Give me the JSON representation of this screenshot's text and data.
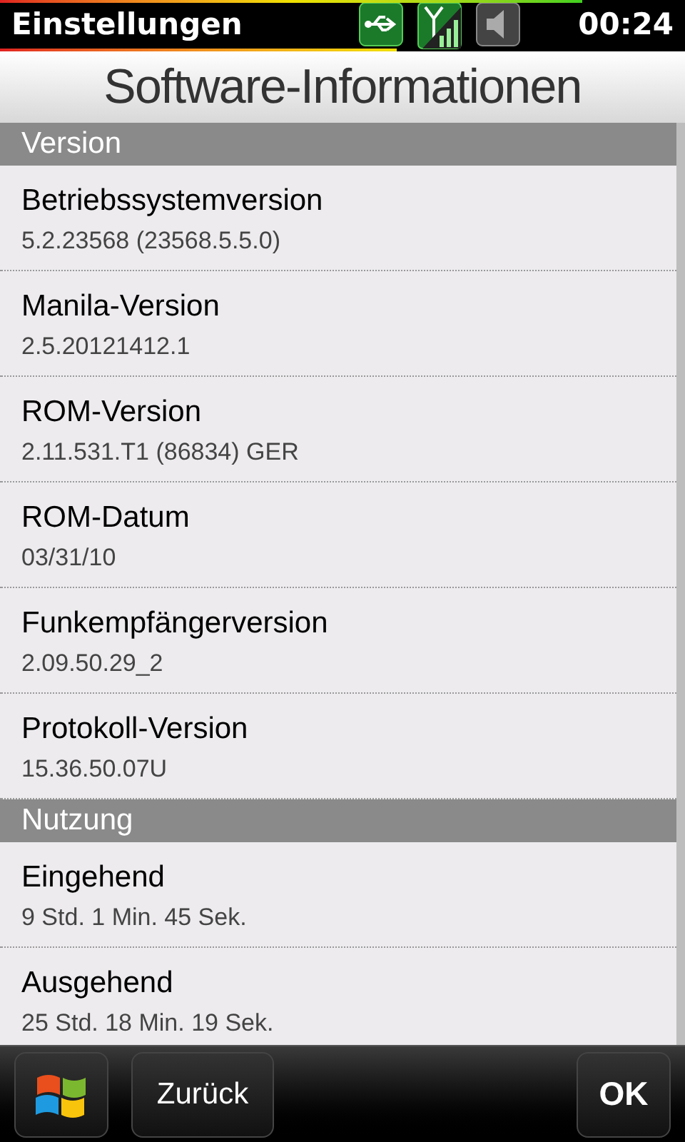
{
  "status_bar": {
    "title": "Einstellungen",
    "time": "00:24"
  },
  "page_title": "Software-Informationen",
  "sections": [
    {
      "header": "Version",
      "items": [
        {
          "label": "Betriebssystemversion",
          "value": "5.2.23568 (23568.5.5.0)"
        },
        {
          "label": "Manila-Version",
          "value": "2.5.20121412.1"
        },
        {
          "label": "ROM-Version",
          "value": "2.11.531.T1 (86834) GER"
        },
        {
          "label": "ROM-Datum",
          "value": "03/31/10"
        },
        {
          "label": "Funkempfängerversion",
          "value": "2.09.50.29_2"
        },
        {
          "label": "Protokoll-Version",
          "value": "15.36.50.07U"
        }
      ]
    },
    {
      "header": "Nutzung",
      "items": [
        {
          "label": "Eingehend",
          "value": "9 Std. 1 Min. 45 Sek."
        },
        {
          "label": "Ausgehend",
          "value": "25 Std. 18 Min. 19 Sek."
        }
      ]
    }
  ],
  "buttons": {
    "back": "Zurück",
    "ok": "OK"
  }
}
